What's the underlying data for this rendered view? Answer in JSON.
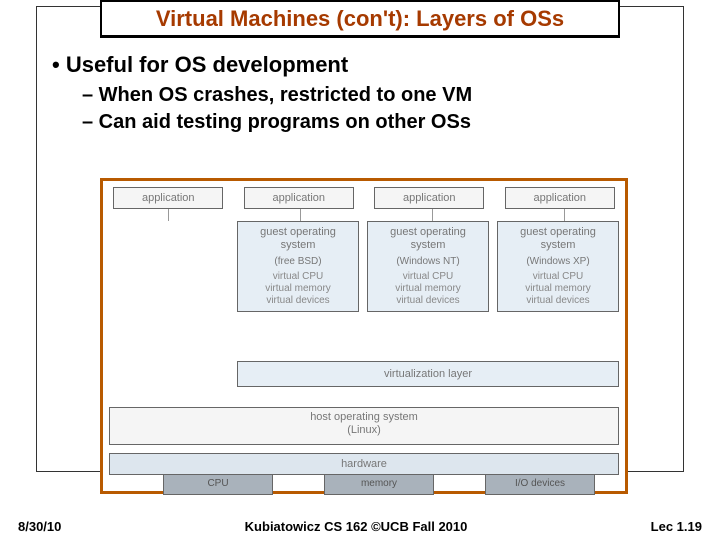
{
  "title": "Virtual Machines (con't): Layers of OSs",
  "bullets": {
    "b1": "• Useful for OS development",
    "s1": "– When OS crashes, restricted to one VM",
    "s2": "– Can aid testing programs on other OSs"
  },
  "diagram": {
    "app": "application",
    "guests": [
      {
        "title": "guest operating\nsystem",
        "sub": "(free BSD)",
        "dev": "virtual CPU\nvirtual memory\nvirtual devices"
      },
      {
        "title": "guest operating\nsystem",
        "sub": "(Windows NT)",
        "dev": "virtual CPU\nvirtual memory\nvirtual devices"
      },
      {
        "title": "guest operating\nsystem",
        "sub": "(Windows XP)",
        "dev": "virtual CPU\nvirtual memory\nvirtual devices"
      }
    ],
    "virt": "virtualization layer",
    "host": "host operating system",
    "host_sub": "(Linux)",
    "hw": "hardware",
    "hw_sub": [
      "CPU",
      "memory",
      "I/O devices"
    ]
  },
  "footer": {
    "date": "8/30/10",
    "center": "Kubiatowicz CS 162 ©UCB Fall 2010",
    "right": "Lec 1.19"
  }
}
